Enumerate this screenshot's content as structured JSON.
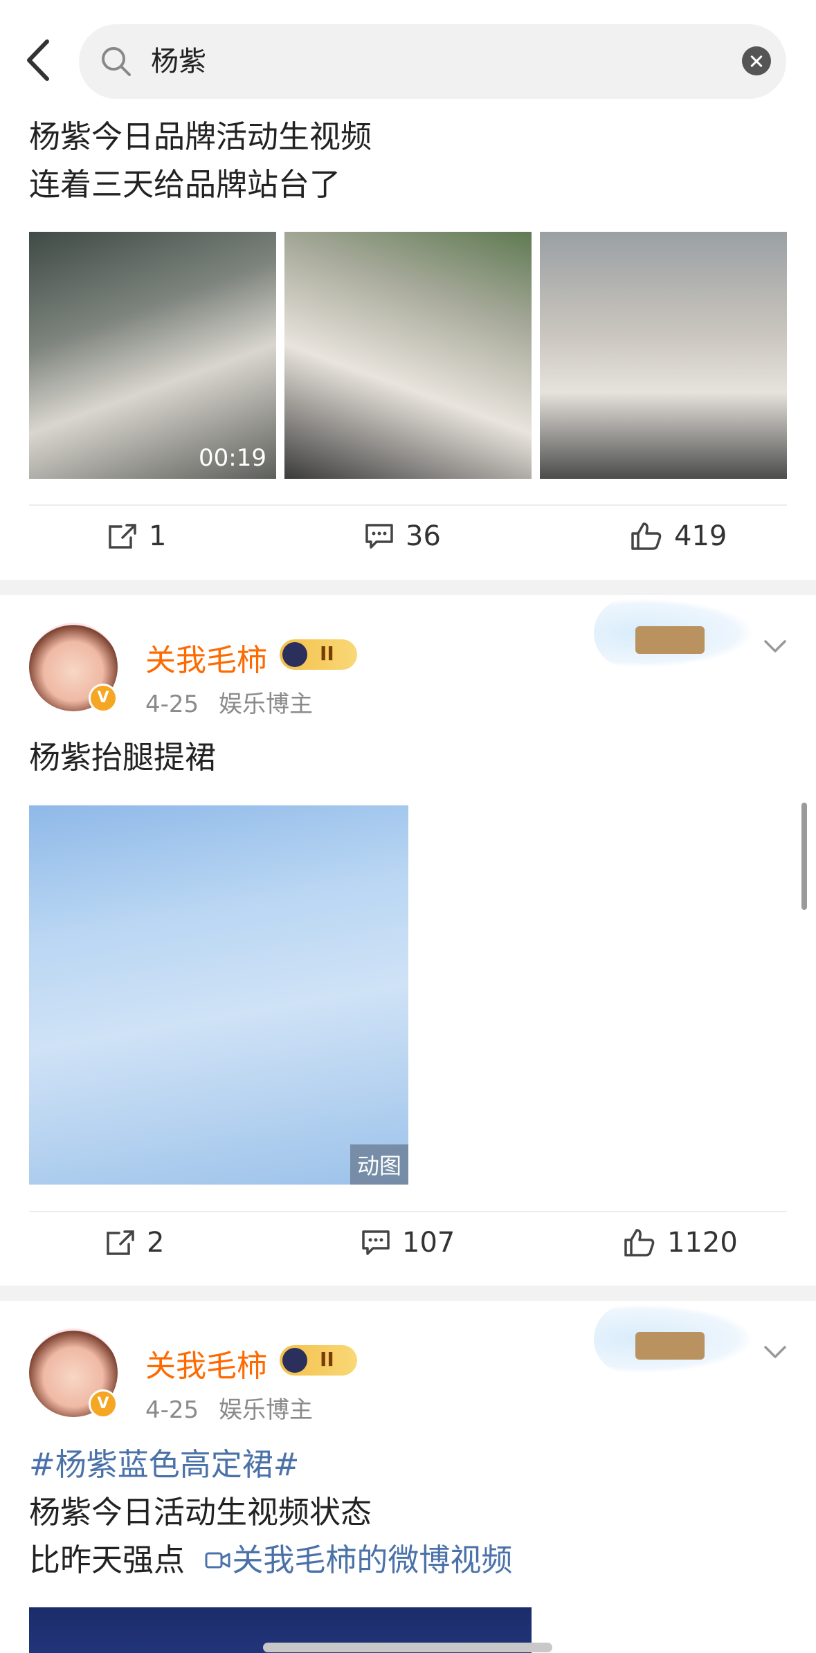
{
  "search": {
    "query": "杨紫"
  },
  "posts": [
    {
      "lines": [
        "杨紫今日品牌活动生视频",
        "连着三天给品牌站台了"
      ],
      "video_duration": "00:19",
      "actions": {
        "repost": "1",
        "comment": "36",
        "like": "419"
      }
    },
    {
      "author": "关我毛柿",
      "date": "4-25",
      "role": "娱乐博主",
      "vip_level": "II",
      "text": "杨紫抬腿提裙",
      "media_badge": "动图",
      "actions": {
        "repost": "2",
        "comment": "107",
        "like": "1120"
      }
    },
    {
      "author": "关我毛柿",
      "date": "4-25",
      "role": "娱乐博主",
      "vip_level": "II",
      "hashtag": "#杨紫蓝色高定裙#",
      "line1": "杨紫今日活动生视频状态",
      "line2": "比昨天强点",
      "video_link": "关我毛柿的微博视频"
    }
  ],
  "colors": {
    "author": "#ff6a00",
    "link": "#4a72a8",
    "separator": "#f2f2f2"
  },
  "icons": [
    "back-arrow-icon",
    "search-icon",
    "clear-icon",
    "repost-icon",
    "comment-icon",
    "like-icon",
    "chevron-down-icon",
    "verified-icon",
    "crown-icon",
    "video-link-icon"
  ]
}
